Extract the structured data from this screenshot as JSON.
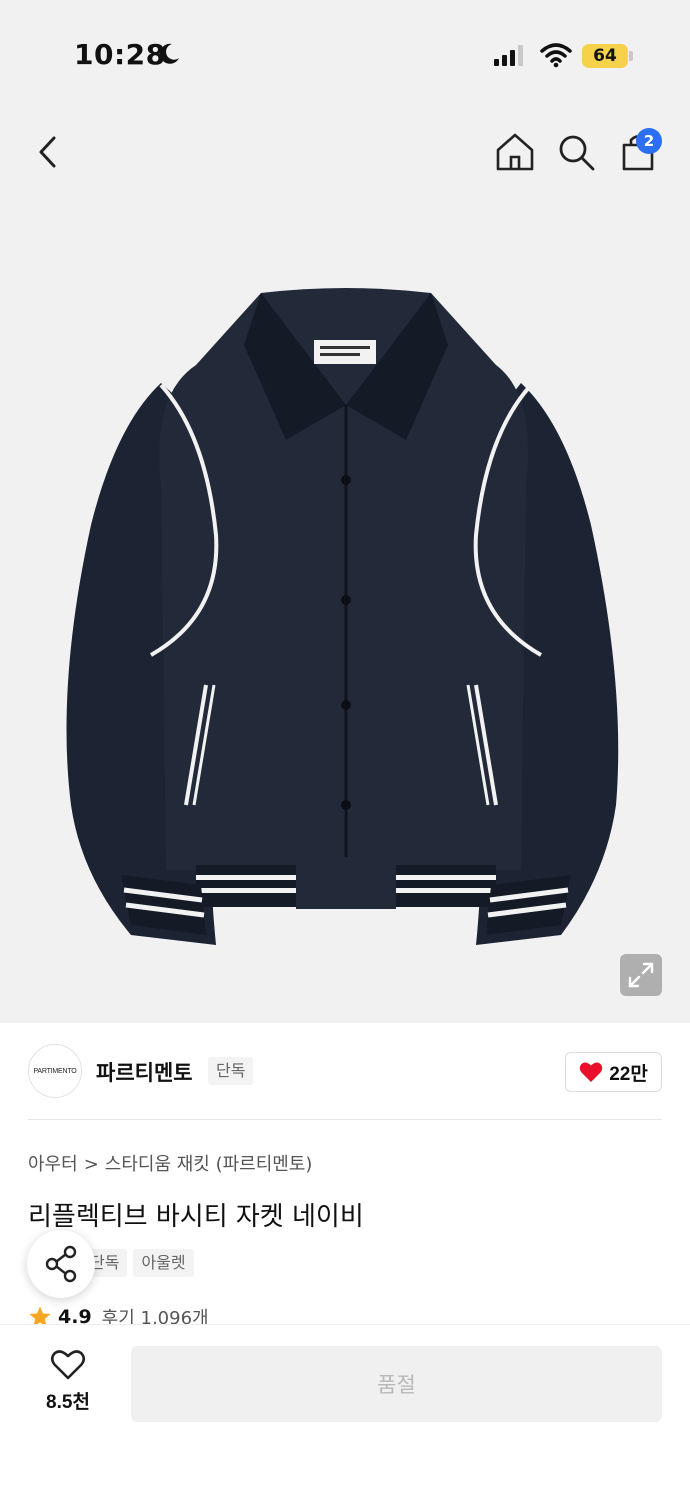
{
  "status_bar": {
    "time": "10:28",
    "battery": "64"
  },
  "nav": {
    "cart_count": "2"
  },
  "brand": {
    "logo_text": "PARTIMENTO",
    "name": "파르티멘토",
    "exclusive_tag": "단독",
    "like_count": "22만"
  },
  "product": {
    "breadcrumb": [
      "아우터",
      ">",
      "스타디움 재킷 (파르티멘토)"
    ],
    "title": "리플렉티브 바시티 자켓 네이비",
    "tags": [
      "단독",
      "아울렛"
    ],
    "rating": "4.9",
    "reviews": "후기 1,096개"
  },
  "bottom_bar": {
    "wish_count": "8.5천",
    "buy_label": "품절"
  },
  "colors": {
    "badge": "#2b6ff2",
    "heart": "#e8102a",
    "star": "#f5a623",
    "jacket": "#1c2333"
  }
}
